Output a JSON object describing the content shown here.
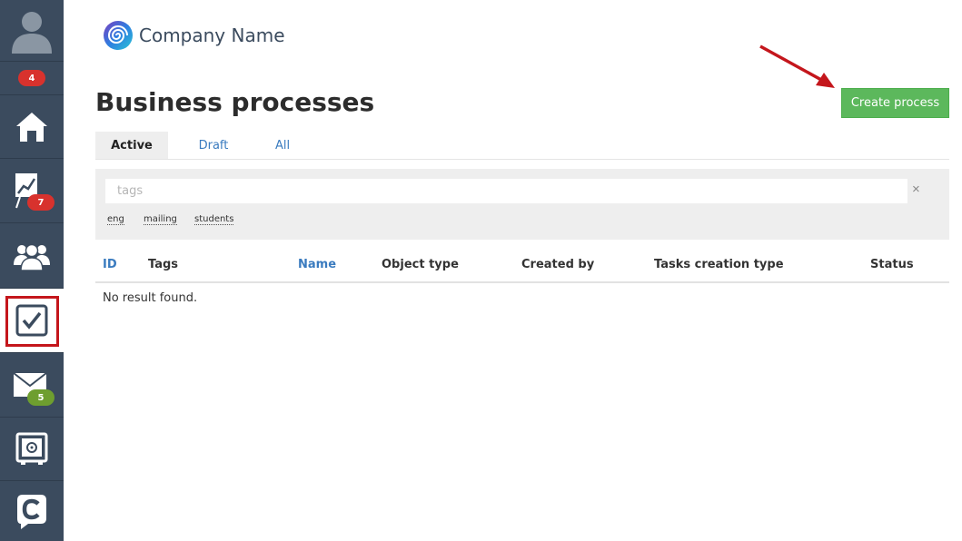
{
  "sidebar": {
    "items": [
      {
        "name": "avatar",
        "icon": "user-avatar-icon"
      },
      {
        "name": "notifications",
        "badge": "4"
      },
      {
        "name": "home",
        "icon": "home-icon"
      },
      {
        "name": "reports",
        "icon": "chart-board-icon",
        "badge": "7"
      },
      {
        "name": "contacts",
        "icon": "users-group-icon"
      },
      {
        "name": "tasks",
        "icon": "checkbox-icon",
        "active": true
      },
      {
        "name": "messages",
        "icon": "envelope-icon",
        "badge": "5"
      },
      {
        "name": "storage",
        "icon": "safe-icon"
      },
      {
        "name": "chat",
        "icon": "chat-c-icon"
      }
    ],
    "badge_colors": {
      "red": "#d8322d",
      "green": "#6e9e2f"
    }
  },
  "brand": {
    "name": "Company Name"
  },
  "page": {
    "title": "Business processes",
    "create_button": "Create process"
  },
  "tabs": [
    {
      "label": "Active",
      "active": true
    },
    {
      "label": "Draft",
      "active": false
    },
    {
      "label": "All",
      "active": false
    }
  ],
  "filter": {
    "placeholder": "tags",
    "clear": "×",
    "tags": [
      "eng",
      "mailing",
      "students"
    ]
  },
  "table": {
    "columns": [
      "ID",
      "Tags",
      "Name",
      "Object type",
      "Created by",
      "Tasks creation type",
      "Status"
    ],
    "empty_text": "No result found."
  },
  "colors": {
    "accent": "#3a7bbf",
    "button": "#5cb85c",
    "sidebar": "#3b4b5e",
    "highlight": "#c4161c"
  }
}
